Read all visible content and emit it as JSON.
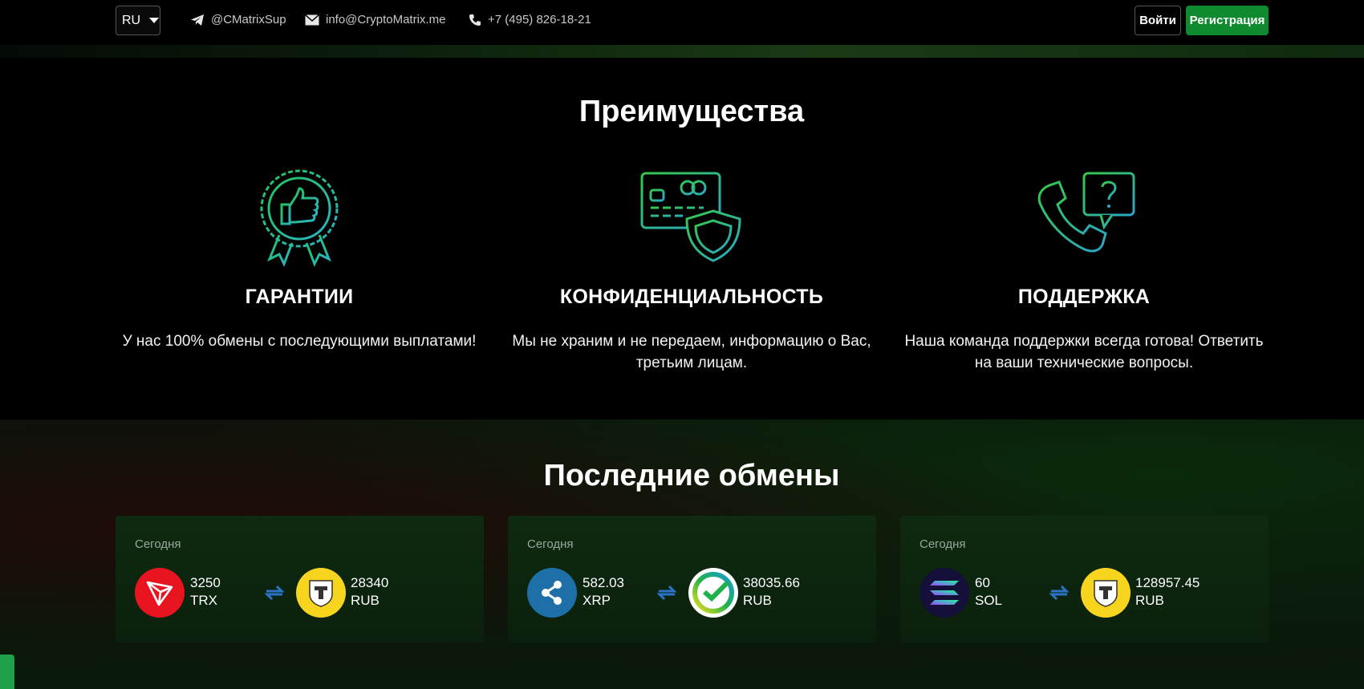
{
  "header": {
    "language": "RU",
    "telegram": "@CMatrixSup",
    "email": "info@CryptoMatrix.me",
    "phone": "+7 (495) 826-18-21",
    "login_label": "Войти",
    "register_label": "Регистрация"
  },
  "advantages": {
    "title": "Преимущества",
    "items": [
      {
        "title": "ГАРАНТИИ",
        "text": "У нас 100% обмены с последующими выплатами!",
        "icon": "thumbs-up-badge-icon"
      },
      {
        "title": "КОНФИДЕНЦИАЛЬНОСТЬ",
        "text": "Мы не храним и не передаем, информацию о Вас, третьим лицам.",
        "icon": "card-shield-icon"
      },
      {
        "title": "ПОДДЕРЖКА",
        "text": "Наша команда поддержки всегда готова! Ответить на ваши технические вопросы.",
        "icon": "phone-question-icon"
      }
    ]
  },
  "exchanges": {
    "title": "Последние обмены",
    "items": [
      {
        "date": "Сегодня",
        "from_amount": "3250",
        "from_currency": "TRX",
        "to_amount": "28340",
        "to_currency": "RUB",
        "from_icon": "tron-icon",
        "to_icon": "tinkoff-icon"
      },
      {
        "date": "Сегодня",
        "from_amount": "582.03",
        "from_currency": "XRP",
        "to_amount": "38035.66",
        "to_currency": "RUB",
        "from_icon": "ripple-icon",
        "to_icon": "sberbank-icon"
      },
      {
        "date": "Сегодня",
        "from_amount": "60",
        "from_currency": "SOL",
        "to_amount": "128957.45",
        "to_currency": "RUB",
        "from_icon": "solana-icon",
        "to_icon": "tinkoff-icon"
      }
    ]
  },
  "colors": {
    "accent_green": "#0f8a2e",
    "tron_red": "#e8141f",
    "ripple_blue": "#1e6fa8",
    "tinkoff_yellow": "#f7d51e"
  }
}
